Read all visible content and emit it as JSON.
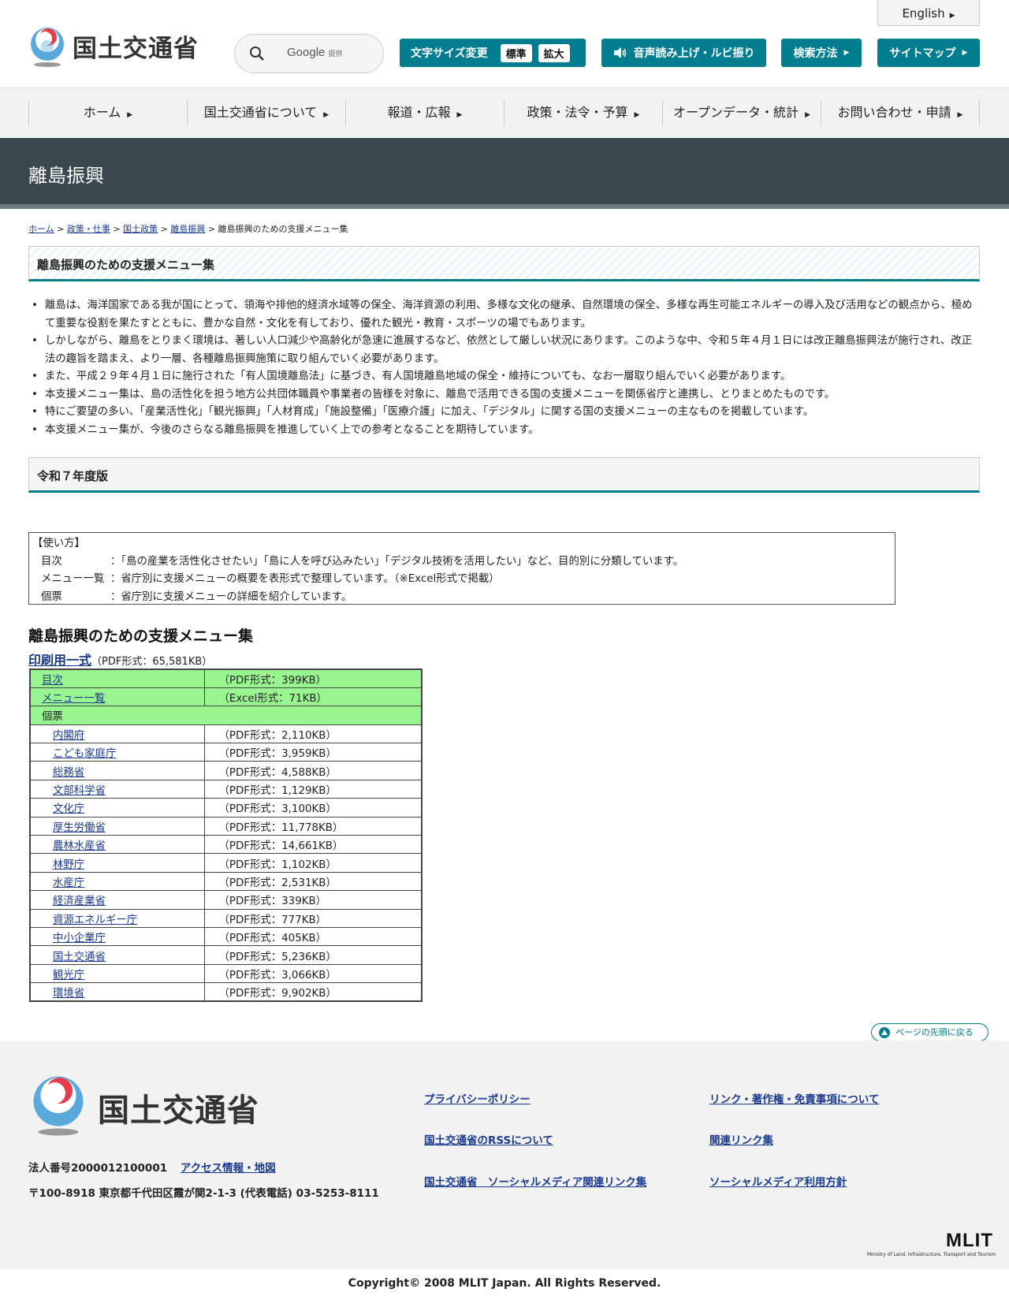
{
  "header": {
    "logo_text": "国土交通省",
    "search_placeholder": "Google",
    "search_provided": "提供",
    "english": "English",
    "font_size_label": "文字サイズ変更",
    "font_size_standard": "標準",
    "font_size_large": "拡大",
    "voice_label": "音声読み上げ・ルビ振り",
    "search_method": "検索方法",
    "sitemap": "サイトマップ"
  },
  "nav": [
    "ホーム",
    "国土交通省について",
    "報道・広報",
    "政策・法令・予算",
    "オープンデータ・統計",
    "お問い合わせ・申請"
  ],
  "band_title": "離島振興",
  "breadcrumb": {
    "items": [
      "ホーム",
      "政策・仕事",
      "国土政策",
      "離島振興"
    ],
    "current": "離島振興のための支援メニュー集",
    "sep": ">"
  },
  "page_heading": "離島振興のための支援メニュー集",
  "intro": [
    "離島は、海洋国家である我が国にとって、領海や排他的経済水域等の保全、海洋資源の利用、多様な文化の継承、自然環境の保全、多様な再生可能エネルギーの導入及び活用などの観点から、極めて重要な役割を果たすとともに、豊かな自然・文化を有しており、優れた観光・教育・スポーツの場でもあります。",
    "しかしながら、離島をとりまく環境は、著しい人口減少や高齢化が急速に進展するなど、依然として厳しい状況にあります。このような中、令和５年４月１日には改正離島振興法が施行され、改正法の趣旨を踏まえ、より一層、各種離島振興施策に取り組んでいく必要があります。",
    "また、平成２９年４月１日に施行された「有人国境離島法」に基づき、有人国境離島地域の保全・維持についても、なお一層取り組んでいく必要があります。",
    "本支援メニュー集は、島の活性化を担う地方公共団体職員や事業者の皆様を対象に、離島で活用できる国の支援メニューを関係省庁と連携し、とりまとめたものです。",
    "特にご要望の多い、「産業活性化」「観光振興」「人材育成」「施設整備」「医療介護」に加え、「デジタル」に関する国の支援メニューの主なものを掲載しています。",
    "本支援メニュー集が、今後のさらなる離島振興を推進していく上での参考となることを期待しています。"
  ],
  "edition_heading": "令和７年度版",
  "usage": {
    "title": "【使い方】",
    "rows": [
      {
        "k": "目次",
        "v": "：「島の産業を活性化させたい」「島に人を呼び込みたい」「デジタル技術を活用したい」など、目的別に分類しています。"
      },
      {
        "k": "メニュー一覧",
        "v": "：省庁別に支援メニューの概要を表形式で整理しています。（※Excel形式で掲載）"
      },
      {
        "k": "個票",
        "v": "：省庁別に支援メニューの詳細を紹介しています。"
      }
    ]
  },
  "menu_title": "離島振興のための支援メニュー集",
  "print": {
    "link": "印刷用一式",
    "info": "（PDF形式：65,581KB）"
  },
  "table": {
    "top_rows": [
      {
        "name": "目次",
        "info": "（PDF形式：399KB）"
      },
      {
        "name": "メニュー一覧",
        "info": "（Excel形式：71KB）"
      }
    ],
    "group_label": "個票",
    "items": [
      {
        "name": "内閣府",
        "info": "（PDF形式：2,110KB）"
      },
      {
        "name": "こども家庭庁",
        "info": "（PDF形式：3,959KB）"
      },
      {
        "name": "総務省",
        "info": "（PDF形式：4,588KB）"
      },
      {
        "name": "文部科学省",
        "info": "（PDF形式：1,129KB）"
      },
      {
        "name": "文化庁",
        "info": "（PDF形式：3,100KB）"
      },
      {
        "name": "厚生労働省",
        "info": "（PDF形式：11,778KB）"
      },
      {
        "name": "農林水産省",
        "info": "（PDF形式：14,661KB）"
      },
      {
        "name": "林野庁",
        "info": "（PDF形式：1,102KB）"
      },
      {
        "name": "水産庁",
        "info": "（PDF形式：2,531KB）"
      },
      {
        "name": "経済産業省",
        "info": "（PDF形式：339KB）"
      },
      {
        "name": "資源エネルギー庁",
        "info": "（PDF形式：777KB）"
      },
      {
        "name": "中小企業庁",
        "info": "（PDF形式：405KB）"
      },
      {
        "name": "国土交通省",
        "info": "（PDF形式：5,236KB）"
      },
      {
        "name": "観光庁",
        "info": "（PDF形式：3,066KB）"
      },
      {
        "name": "環境省",
        "info": "（PDF形式：9,902KB）"
      }
    ]
  },
  "pagetop": "ページの先頭に戻る",
  "footer": {
    "logo_text": "国土交通省",
    "corp_number": "法人番号2000012100001",
    "access": "アクセス情報・地図",
    "address": "〒100-8918 東京都千代田区霞が関2-1-3 (代表電話) 03-5253-8111",
    "links": [
      "プライバシーポリシー",
      "国土交通省のRSSについて",
      "国土交通省　ソーシャルメディア関連リンク集",
      "リンク・著作権・免責事項について",
      "関連リンク集",
      "ソーシャルメディア利用方針"
    ],
    "mlit": "MLIT",
    "mlit_sub": "Ministry of Land, Infrastructure, Transport and Tourism",
    "copyright": "Copyright© 2008 MLIT Japan. All Rights Reserved."
  },
  "colors": {
    "accent": "#007d8f",
    "band": "#3b474e",
    "table_green": "#99f58f",
    "link": "#1a3a8f"
  }
}
